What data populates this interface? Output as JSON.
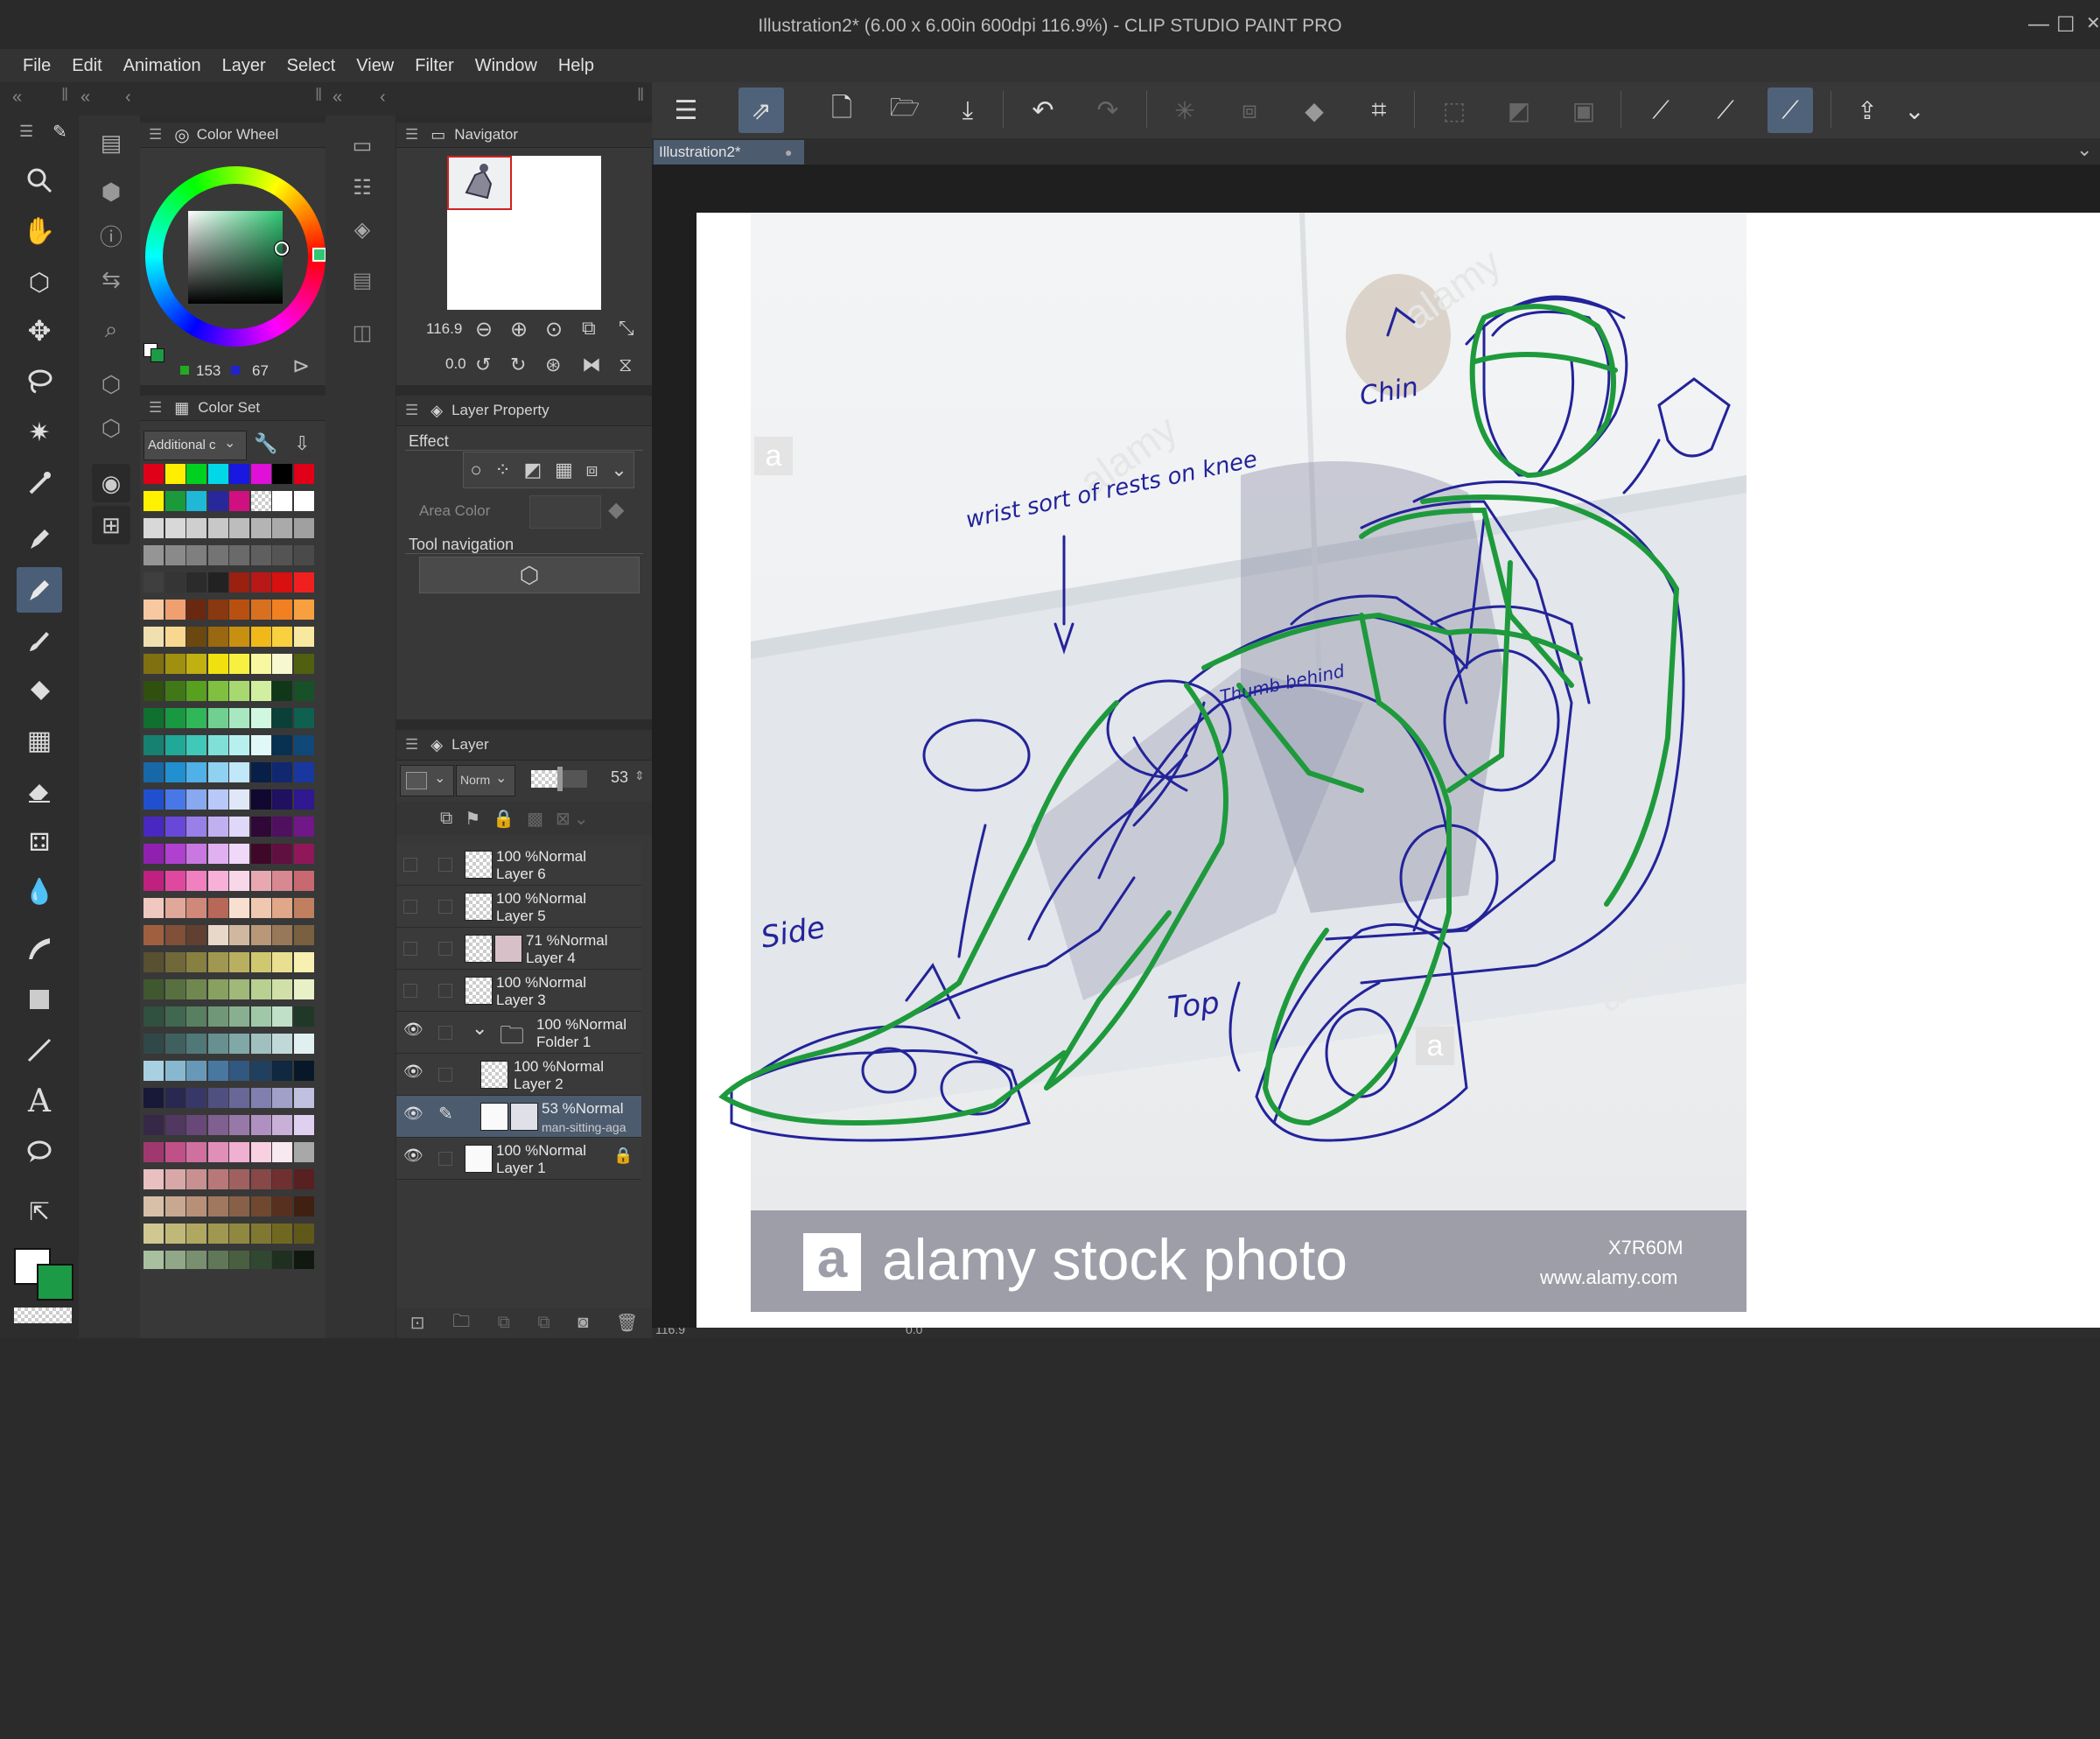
{
  "window": {
    "title": "Illustration2* (6.00 x 6.00in 600dpi 116.9%)  - CLIP STUDIO PAINT PRO",
    "minimize_glyph": "—",
    "maximize_glyph": "☐",
    "close_glyph": "✕"
  },
  "menu": [
    "File",
    "Edit",
    "Animation",
    "Layer",
    "Select",
    "View",
    "Filter",
    "Window",
    "Help"
  ],
  "color_wheel": {
    "title": "Color Wheel",
    "value_a": "153",
    "value_b": "67",
    "current_color": "#2e9e5a"
  },
  "color_set": {
    "title": "Color Set",
    "set_name": "Additional c",
    "swatch_rows": [
      [
        "#e00018",
        "#ffee00",
        "#00d020",
        "#00d8e8",
        "#1818e0",
        "#e010d8",
        "#000000",
        "#e00018"
      ],
      [
        "#fff200",
        "#1a9a3a",
        "#1fb8d6",
        "#28289a",
        "#d01080",
        "checker",
        "#ffffff",
        "#ffffff"
      ],
      [
        "#d8d8d8",
        "#d8d8d8",
        "#cfcfcf",
        "#c8c8c8",
        "#bdbdbd",
        "#b4b4b4",
        "#aaaaaa",
        "#a0a0a0"
      ],
      [
        "#959595",
        "#8a8a8a",
        "#7f7f7f",
        "#747474",
        "#6a6a6a",
        "#5f5f5f",
        "#545454",
        "#4a4a4a"
      ],
      [
        "#3f3f3f",
        "#353535",
        "#2b2b2b",
        "#222222",
        "#9a2010",
        "#b81818",
        "#d81010",
        "#f02020"
      ],
      [
        "#f8c8a0",
        "#f0a070",
        "#6a2810",
        "#8a3810",
        "#b85010",
        "#d87020",
        "#f08020",
        "#f8a040"
      ],
      [
        "#f0e0b0",
        "#f8d890",
        "#6a4810",
        "#9a6810",
        "#c89010",
        "#f0b818",
        "#f8d040",
        "#f8e8a0"
      ],
      [
        "#807010",
        "#a09010",
        "#c0b010",
        "#f0e010",
        "#f8f040",
        "#f8f8a0",
        "#f8f8d0",
        "#506010"
      ],
      [
        "#305010",
        "#407818",
        "#58a020",
        "#80c040",
        "#a8d870",
        "#d0f0a0",
        "#103818",
        "#185028"
      ],
      [
        "#107030",
        "#189840",
        "#30b858",
        "#70d090",
        "#a8e8c0",
        "#d0f8e0",
        "#0a4038",
        "#106050"
      ],
      [
        "#188070",
        "#20a898",
        "#40c8b8",
        "#80e0d8",
        "#b8f0f0",
        "#e0f8f8",
        "#083050",
        "#104878"
      ],
      [
        "#1868a8",
        "#2090d0",
        "#50b0e8",
        "#90d0f0",
        "#c0e8f8",
        "#082048",
        "#102870",
        "#1838a0"
      ],
      [
        "#2050d0",
        "#4878e8",
        "#88a8f0",
        "#b8c8f8",
        "#e0e8f8",
        "#100830",
        "#201060",
        "#301890"
      ],
      [
        "#4828c0",
        "#6848d8",
        "#9880e8",
        "#c0b0f0",
        "#e0d8f8",
        "#300838",
        "#501060",
        "#701888"
      ],
      [
        "#9020b0",
        "#b040d0",
        "#c878e0",
        "#e0b0f0",
        "#f0d8f8",
        "#400828",
        "#601040",
        "#901858"
      ],
      [
        "#c02080",
        "#e048a0",
        "#f080c0",
        "#f8b0d8",
        "#f8d8e8",
        "#e8a8b0",
        "#d88890",
        "#c86870"
      ],
      [
        "#f0c8c0",
        "#e0a898",
        "#d08878",
        "#b86858",
        "#f8e0d0",
        "#f0c8b0",
        "#e0a888",
        "#c08060"
      ],
      [
        "#a06040",
        "#805038",
        "#604030",
        "#e8d8c8",
        "#d0b8a0",
        "#b89878",
        "#987858",
        "#786040"
      ],
      [
        "#585030",
        "#706838",
        "#888040",
        "#a09850",
        "#b8b060",
        "#d0c870",
        "#e8e090",
        "#f8f0b0"
      ],
      [
        "#405830",
        "#587040",
        "#708850",
        "#88a060",
        "#a0b878",
        "#b8d090",
        "#d0e0a8",
        "#e8f0c8"
      ],
      [
        "#305040",
        "#406850",
        "#588060",
        "#709878",
        "#88b090",
        "#a0c8a8",
        "#c0e0c8",
        "#203828"
      ],
      [
        "#304848",
        "#406060",
        "#507878",
        "#689090",
        "#80a8a8",
        "#a0c0c0",
        "#c0d8d8",
        "#e0f0f0"
      ],
      [
        "#a8d0e0",
        "#88b8d0",
        "#6898b8",
        "#4878a0",
        "#305880",
        "#204060",
        "#102840",
        "#081828"
      ],
      [
        "#181838",
        "#282850",
        "#383868",
        "#505080",
        "#686898",
        "#8080b0",
        "#a0a0c8",
        "#c0c0e0"
      ],
      [
        "#382848",
        "#503860",
        "#684878",
        "#806090",
        "#9878a8",
        "#b090c0",
        "#c8b0d8",
        "#e0d0f0"
      ],
      [
        "#a03870",
        "#c05088",
        "#d070a0",
        "#e090b8",
        "#f0b0d0",
        "#f8d0e0",
        "#f8e8f0",
        "#a8a8a8"
      ],
      [
        "#e8c0c0",
        "#d8a8a8",
        "#c89090",
        "#b87878",
        "#a06060",
        "#884848",
        "#703030",
        "#582020"
      ],
      [
        "#d8c0a8",
        "#c8a890",
        "#b89078",
        "#a07860",
        "#886048",
        "#704830",
        "#583020",
        "#402010"
      ],
      [
        "#d0c890",
        "#c0b878",
        "#b0a860",
        "#a09850",
        "#908840",
        "#807830",
        "#706820",
        "#605818"
      ],
      [
        "#a8c0a0",
        "#90a888",
        "#789070",
        "#607858",
        "#486040",
        "#304830",
        "#203020",
        "#101810"
      ]
    ]
  },
  "navigator": {
    "title": "Navigator",
    "zoom": "116.9",
    "rotation": "0.0"
  },
  "layer_property": {
    "title": "Layer Property",
    "effect_label": "Effect",
    "area_color_label": "Area Color",
    "tool_navigation_label": "Tool navigation"
  },
  "layer_panel": {
    "title": "Layer",
    "blend_mode": "Norm",
    "opacity": "53",
    "layers": [
      {
        "name": "Layer 6",
        "mode": "100 %Normal",
        "visible": false
      },
      {
        "name": "Layer 5",
        "mode": "100 %Normal",
        "visible": false
      },
      {
        "name": "Layer 4",
        "mode": "71 %Normal",
        "visible": false
      },
      {
        "name": "Layer 3",
        "mode": "100 %Normal",
        "visible": false
      },
      {
        "name": "Folder 1",
        "mode": "100 %Normal",
        "visible": true
      },
      {
        "name": "Layer 2",
        "mode": "100 %Normal",
        "visible": true
      },
      {
        "name": "man-sitting-aga",
        "mode": "53 %Normal",
        "visible": true
      },
      {
        "name": "Layer 1",
        "mode": "100 %Normal",
        "visible": true
      }
    ]
  },
  "document_tab": {
    "name": "Illustration2*"
  },
  "canvas": {
    "annotations": [
      "Chin",
      "wrist sort of rests on knee",
      "Thumb behind",
      "Side",
      "Top"
    ],
    "watermark_brand": "alamy stock photo",
    "watermark_logo_letter": "a",
    "watermark_id": "X7R60M",
    "watermark_url": "www.alamy.com",
    "watermark_repeat": "alamy",
    "stroke_colors": {
      "sketch_blue": "#23239a",
      "guide_green": "#1e9a3c"
    }
  },
  "status_bar": {
    "zoom": "116.9",
    "rotation": "0.0"
  },
  "colors": {
    "foreground": "#ffffff",
    "background": "#1d9a45"
  }
}
